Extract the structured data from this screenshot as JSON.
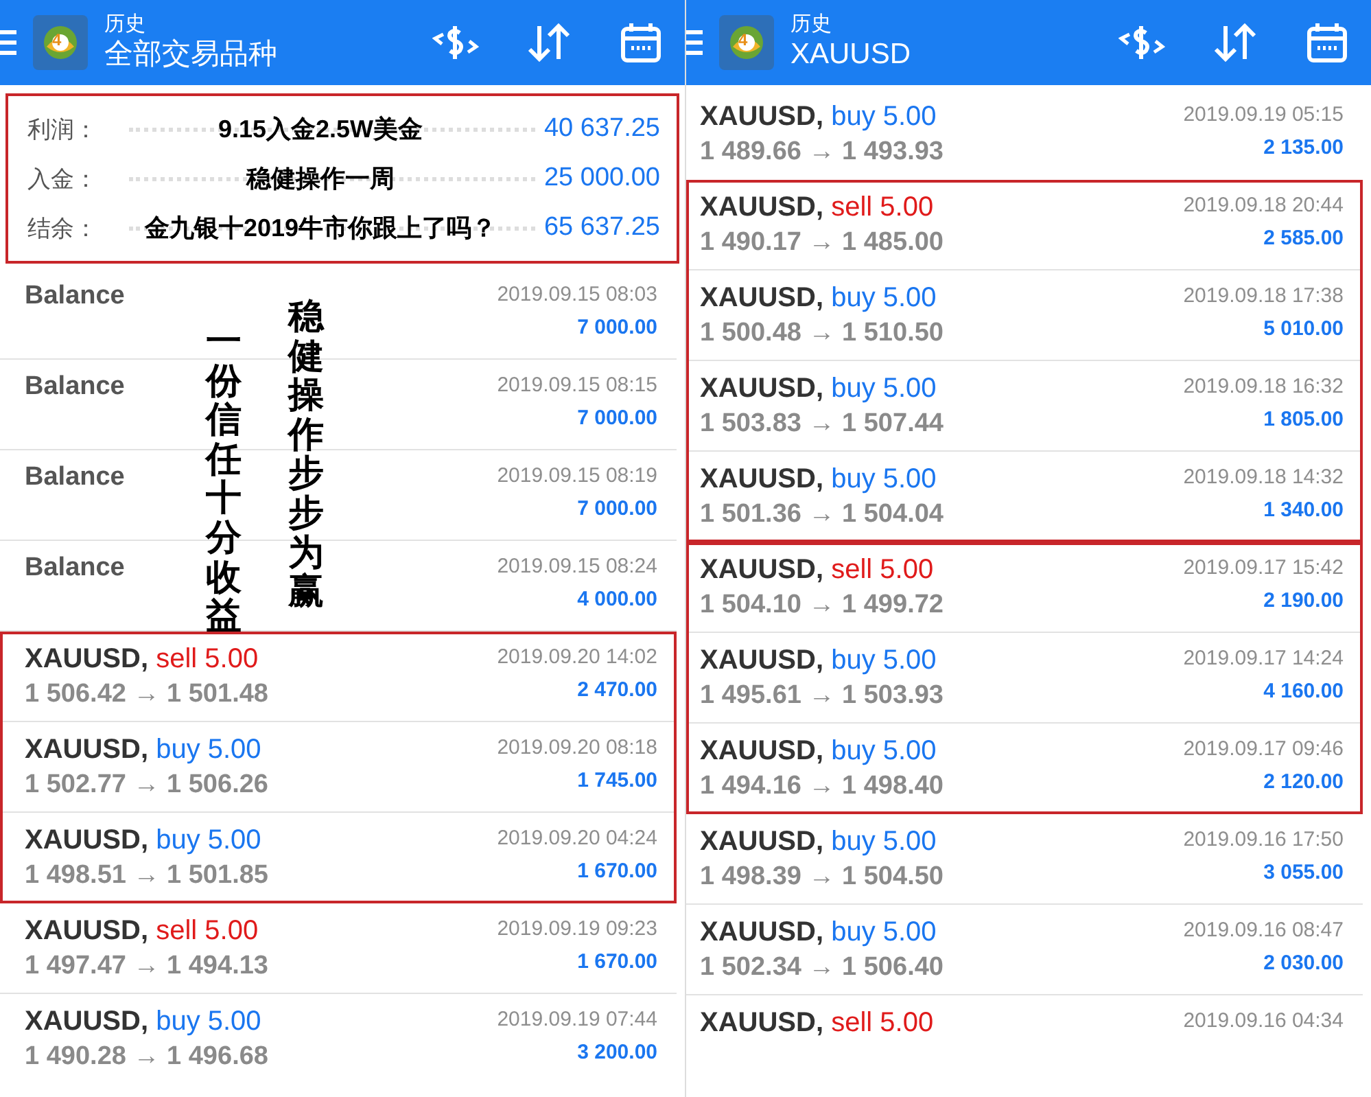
{
  "panels": [
    {
      "header": {
        "title": "历史",
        "subtitle": "全部交易品种",
        "logo_badge": "4"
      },
      "summary": {
        "rows": [
          {
            "label": "利润：",
            "caption": "9.15入金2.5W美金",
            "value": "40 637.25"
          },
          {
            "label": "入金：",
            "caption": "稳健操作一周",
            "value": "25 000.00"
          },
          {
            "label": "结余：",
            "caption": "金九银十2019牛市你跟上了吗？",
            "value": "65 637.25"
          }
        ]
      },
      "groups": [
        {
          "highlighted": false,
          "vertical_captions": [
            "一份信任十分收益",
            "稳健操作步步为赢"
          ],
          "rows": [
            {
              "kind": "balance",
              "title": "Balance",
              "time": "2019.09.15 08:03",
              "amount": "7 000.00"
            },
            {
              "kind": "balance",
              "title": "Balance",
              "time": "2019.09.15 08:15",
              "amount": "7 000.00"
            },
            {
              "kind": "balance",
              "title": "Balance",
              "time": "2019.09.15 08:19",
              "amount": "7 000.00"
            },
            {
              "kind": "balance",
              "title": "Balance",
              "time": "2019.09.15 08:24",
              "amount": "4 000.00"
            }
          ]
        },
        {
          "highlighted": true,
          "rows": [
            {
              "kind": "trade",
              "symbol": "XAUUSD,",
              "side": "sell 5.00",
              "color": "#e01b1b",
              "prices": "1 506.42 → 1 501.48",
              "time": "2019.09.20 14:02",
              "amount": "2 470.00"
            },
            {
              "kind": "trade",
              "symbol": "XAUUSD,",
              "side": "buy 5.00",
              "color": "#1a76f0",
              "prices": "1 502.77 → 1 506.26",
              "time": "2019.09.20 08:18",
              "amount": "1 745.00"
            },
            {
              "kind": "trade",
              "symbol": "XAUUSD,",
              "side": "buy 5.00",
              "color": "#1a76f0",
              "prices": "1 498.51 → 1 501.85",
              "time": "2019.09.20 04:24",
              "amount": "1 670.00"
            }
          ]
        },
        {
          "highlighted": false,
          "rows": [
            {
              "kind": "trade",
              "symbol": "XAUUSD,",
              "side": "sell 5.00",
              "color": "#e01b1b",
              "prices": "1 497.47 → 1 494.13",
              "time": "2019.09.19 09:23",
              "amount": "1 670.00"
            },
            {
              "kind": "trade",
              "symbol": "XAUUSD,",
              "side": "buy 5.00",
              "color": "#1a76f0",
              "prices": "1 490.28 → 1 496.68",
              "time": "2019.09.19 07:44",
              "amount": "3 200.00"
            }
          ]
        }
      ]
    },
    {
      "header": {
        "title": "历史",
        "subtitle": "XAUUSD",
        "logo_badge": "4"
      },
      "groups": [
        {
          "highlighted": false,
          "rows": [
            {
              "kind": "trade",
              "symbol": "XAUUSD,",
              "side": "buy 5.00",
              "color": "#1a76f0",
              "prices": "1 489.66 → 1 493.93",
              "time": "2019.09.19 05:15",
              "amount": "2 135.00"
            }
          ]
        },
        {
          "highlighted": true,
          "rows": [
            {
              "kind": "trade",
              "symbol": "XAUUSD,",
              "side": "sell 5.00",
              "color": "#e01b1b",
              "prices": "1 490.17 → 1 485.00",
              "time": "2019.09.18 20:44",
              "amount": "2 585.00"
            },
            {
              "kind": "trade",
              "symbol": "XAUUSD,",
              "side": "buy 5.00",
              "color": "#1a76f0",
              "prices": "1 500.48 → 1 510.50",
              "time": "2019.09.18 17:38",
              "amount": "5 010.00"
            },
            {
              "kind": "trade",
              "symbol": "XAUUSD,",
              "side": "buy 5.00",
              "color": "#1a76f0",
              "prices": "1 503.83 → 1 507.44",
              "time": "2019.09.18 16:32",
              "amount": "1 805.00"
            },
            {
              "kind": "trade",
              "symbol": "XAUUSD,",
              "side": "buy 5.00",
              "color": "#1a76f0",
              "prices": "1 501.36 → 1 504.04",
              "time": "2019.09.18 14:32",
              "amount": "1 340.00"
            }
          ]
        },
        {
          "highlighted": true,
          "rows": [
            {
              "kind": "trade",
              "symbol": "XAUUSD,",
              "side": "sell 5.00",
              "color": "#e01b1b",
              "prices": "1 504.10 → 1 499.72",
              "time": "2019.09.17 15:42",
              "amount": "2 190.00"
            },
            {
              "kind": "trade",
              "symbol": "XAUUSD,",
              "side": "buy 5.00",
              "color": "#1a76f0",
              "prices": "1 495.61 → 1 503.93",
              "time": "2019.09.17 14:24",
              "amount": "4 160.00"
            },
            {
              "kind": "trade",
              "symbol": "XAUUSD,",
              "side": "buy 5.00",
              "color": "#1a76f0",
              "prices": "1 494.16 → 1 498.40",
              "time": "2019.09.17 09:46",
              "amount": "2 120.00"
            }
          ]
        },
        {
          "highlighted": false,
          "rows": [
            {
              "kind": "trade",
              "symbol": "XAUUSD,",
              "side": "buy 5.00",
              "color": "#1a76f0",
              "prices": "1 498.39 → 1 504.50",
              "time": "2019.09.16 17:50",
              "amount": "3 055.00"
            },
            {
              "kind": "trade",
              "symbol": "XAUUSD,",
              "side": "buy 5.00",
              "color": "#1a76f0",
              "prices": "1 502.34 → 1 506.40",
              "time": "2019.09.16 08:47",
              "amount": "2 030.00"
            },
            {
              "kind": "trade",
              "symbol": "XAUUSD,",
              "side": "sell 5.00",
              "color": "#e01b1b",
              "time": "2019.09.16 04:34"
            }
          ]
        }
      ]
    }
  ]
}
